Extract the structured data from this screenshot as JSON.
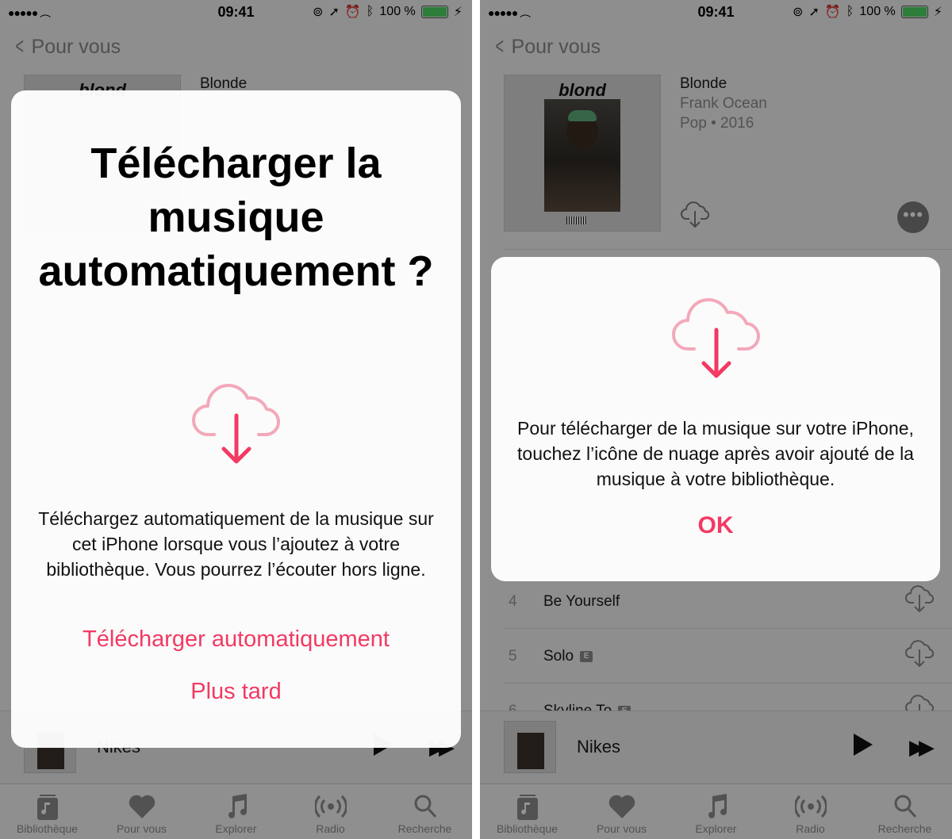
{
  "status": {
    "time": "09:41",
    "battery": "100 %"
  },
  "nav": {
    "back_label": "Pour vous"
  },
  "album": {
    "cover_word": "blond",
    "title": "Blonde",
    "artist": "Frank Ocean",
    "genre_year": "Pop • 2016"
  },
  "tracks": [
    {
      "number": "4",
      "name": "Be Yourself",
      "explicit": false
    },
    {
      "number": "5",
      "name": "Solo",
      "explicit": true
    },
    {
      "number": "6",
      "name": "Skyline To",
      "explicit": true
    }
  ],
  "explicit_badge": "E",
  "miniplayer": {
    "song": "Nikes"
  },
  "tabbar": [
    {
      "label": "Bibliothèque",
      "icon": "library-icon"
    },
    {
      "label": "Pour vous",
      "icon": "heart-icon"
    },
    {
      "label": "Explorer",
      "icon": "music-note-icon"
    },
    {
      "label": "Radio",
      "icon": "radio-icon"
    },
    {
      "label": "Recherche",
      "icon": "search-icon"
    }
  ],
  "dialog_left": {
    "headline": "Télécharger la musique automatiquement ?",
    "body": "Téléchargez automatiquement de la musique sur cet iPhone lorsque vous l’ajoutez à votre bibliothèque. Vous pourrez l’écouter hors ligne.",
    "primary_label": "Télécharger automatiquement",
    "secondary_label": "Plus tard"
  },
  "dialog_right": {
    "body": "Pour télécharger de la musique sur votre iPhone, touchez l’icône de nuage après avoir ajouté de la musique à votre bibliothèque.",
    "ok_label": "OK"
  },
  "colors": {
    "accent": "#f23a63",
    "cloud_light": "#f4a8ba",
    "battery": "#4cd964"
  }
}
